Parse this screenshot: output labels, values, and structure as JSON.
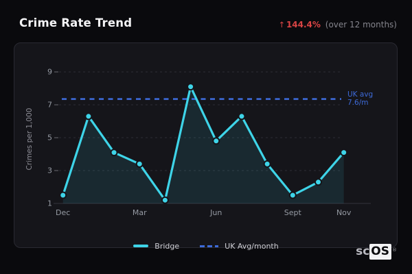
{
  "header": {
    "title": "Crime Rate Trend",
    "trend": {
      "arrow": "↑",
      "value": "144.4%",
      "note": "(over 12 months)"
    }
  },
  "chart_data": {
    "type": "line",
    "title": "Crime Rate Trend",
    "ylabel": "Crimes per 1,000",
    "y_ticks": [
      9,
      7,
      5,
      3,
      1
    ],
    "ylim": [
      1,
      9.5
    ],
    "n_points": 12,
    "grid": true,
    "legend_position": "bottom",
    "x_tick_labels": [
      {
        "index": 0,
        "label": "Dec"
      },
      {
        "index": 3,
        "label": "Mar"
      },
      {
        "index": 6,
        "label": "Jun"
      },
      {
        "index": 9,
        "label": "Sept"
      },
      {
        "index": 11,
        "label": "Nov"
      }
    ],
    "series": [
      {
        "name": "Bridge",
        "color": "#3ed4e8",
        "values": [
          1.5,
          6.3,
          4.1,
          3.4,
          1.2,
          8.1,
          4.8,
          6.3,
          3.4,
          1.5,
          2.3,
          4.1
        ]
      }
    ],
    "reference_line": {
      "name": "UK Avg/month",
      "label": "UK avg",
      "value": 7.6,
      "value_label": "7.6/m",
      "color": "#3d6ad8",
      "style": "dashed"
    },
    "legend": [
      {
        "label": "Bridge",
        "style": "solid",
        "color": "#3ed4e8"
      },
      {
        "label": "UK Avg/month",
        "style": "dashed",
        "color": "#3d6ad8"
      }
    ]
  },
  "colors": {
    "background": "#0a0a0d",
    "card_bg": "#15151a",
    "card_border": "#2a2a32",
    "series": "#3ed4e8",
    "series_fill": "rgba(62,208,228,0.11)",
    "reference": "#3d6ad8",
    "trend_red": "#d84444",
    "grid_line": "#2d2d35",
    "axis_text": "#969ba4"
  },
  "logo": {
    "prefix": "sc",
    "suffix": "OS",
    "registered": "®"
  }
}
